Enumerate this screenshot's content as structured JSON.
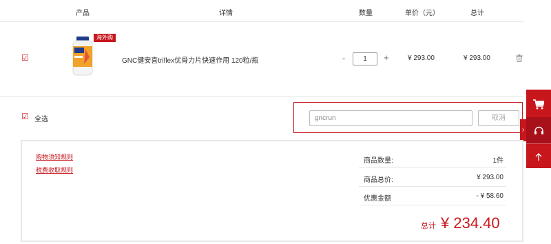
{
  "header": {
    "product": "产品",
    "detail": "详情",
    "qty": "数量",
    "unit_price": "单价（元）",
    "total": "总计"
  },
  "item": {
    "checked": "☑",
    "badge": "海外购",
    "name": "GNC健安喜triflex优骨力片快速作用 120粒/瓶",
    "qty_minus": "-",
    "qty_value": "1",
    "qty_plus": "+",
    "unit_price": "¥ 293.00",
    "row_total": "¥ 293.00"
  },
  "select_all": {
    "checked": "☑",
    "label": "全选"
  },
  "coupon": {
    "value": "gncrun",
    "cancel_label": "取消"
  },
  "sidebar": {
    "arrow": "›"
  },
  "rules": {
    "rule_1": "购物须知规则",
    "rule_2": "税费收取规则"
  },
  "summary": {
    "count_label": "商品数量:",
    "count_value": "1件",
    "goods_total_label": "商品总价:",
    "goods_total_value": "¥ 293.00",
    "discount_label": "优惠金额",
    "discount_value": "- ¥ 58.60",
    "grand_label": "总计",
    "grand_value": "¥ 234.40"
  },
  "colors": {
    "accent": "#c8161d"
  }
}
